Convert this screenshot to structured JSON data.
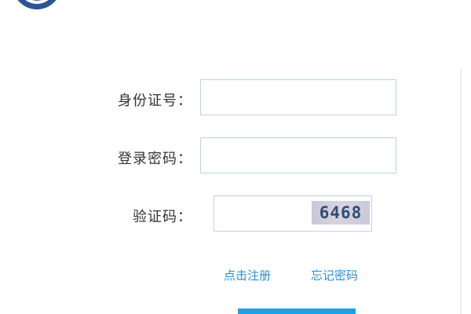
{
  "form": {
    "id_label": "身份证号：",
    "id_value": "",
    "password_label": "登录密码：",
    "password_value": "",
    "captcha_label": "验证码：",
    "captcha_value": "",
    "captcha_image_text": "6468"
  },
  "links": {
    "register": "点击注册",
    "forgot_password": "忘记密码"
  },
  "colors": {
    "link": "#2a8fd6",
    "input_border": "#bcd3e6",
    "submit_button": "#1ca0e6"
  },
  "icons": {
    "logo": "emblem-logo-icon"
  }
}
